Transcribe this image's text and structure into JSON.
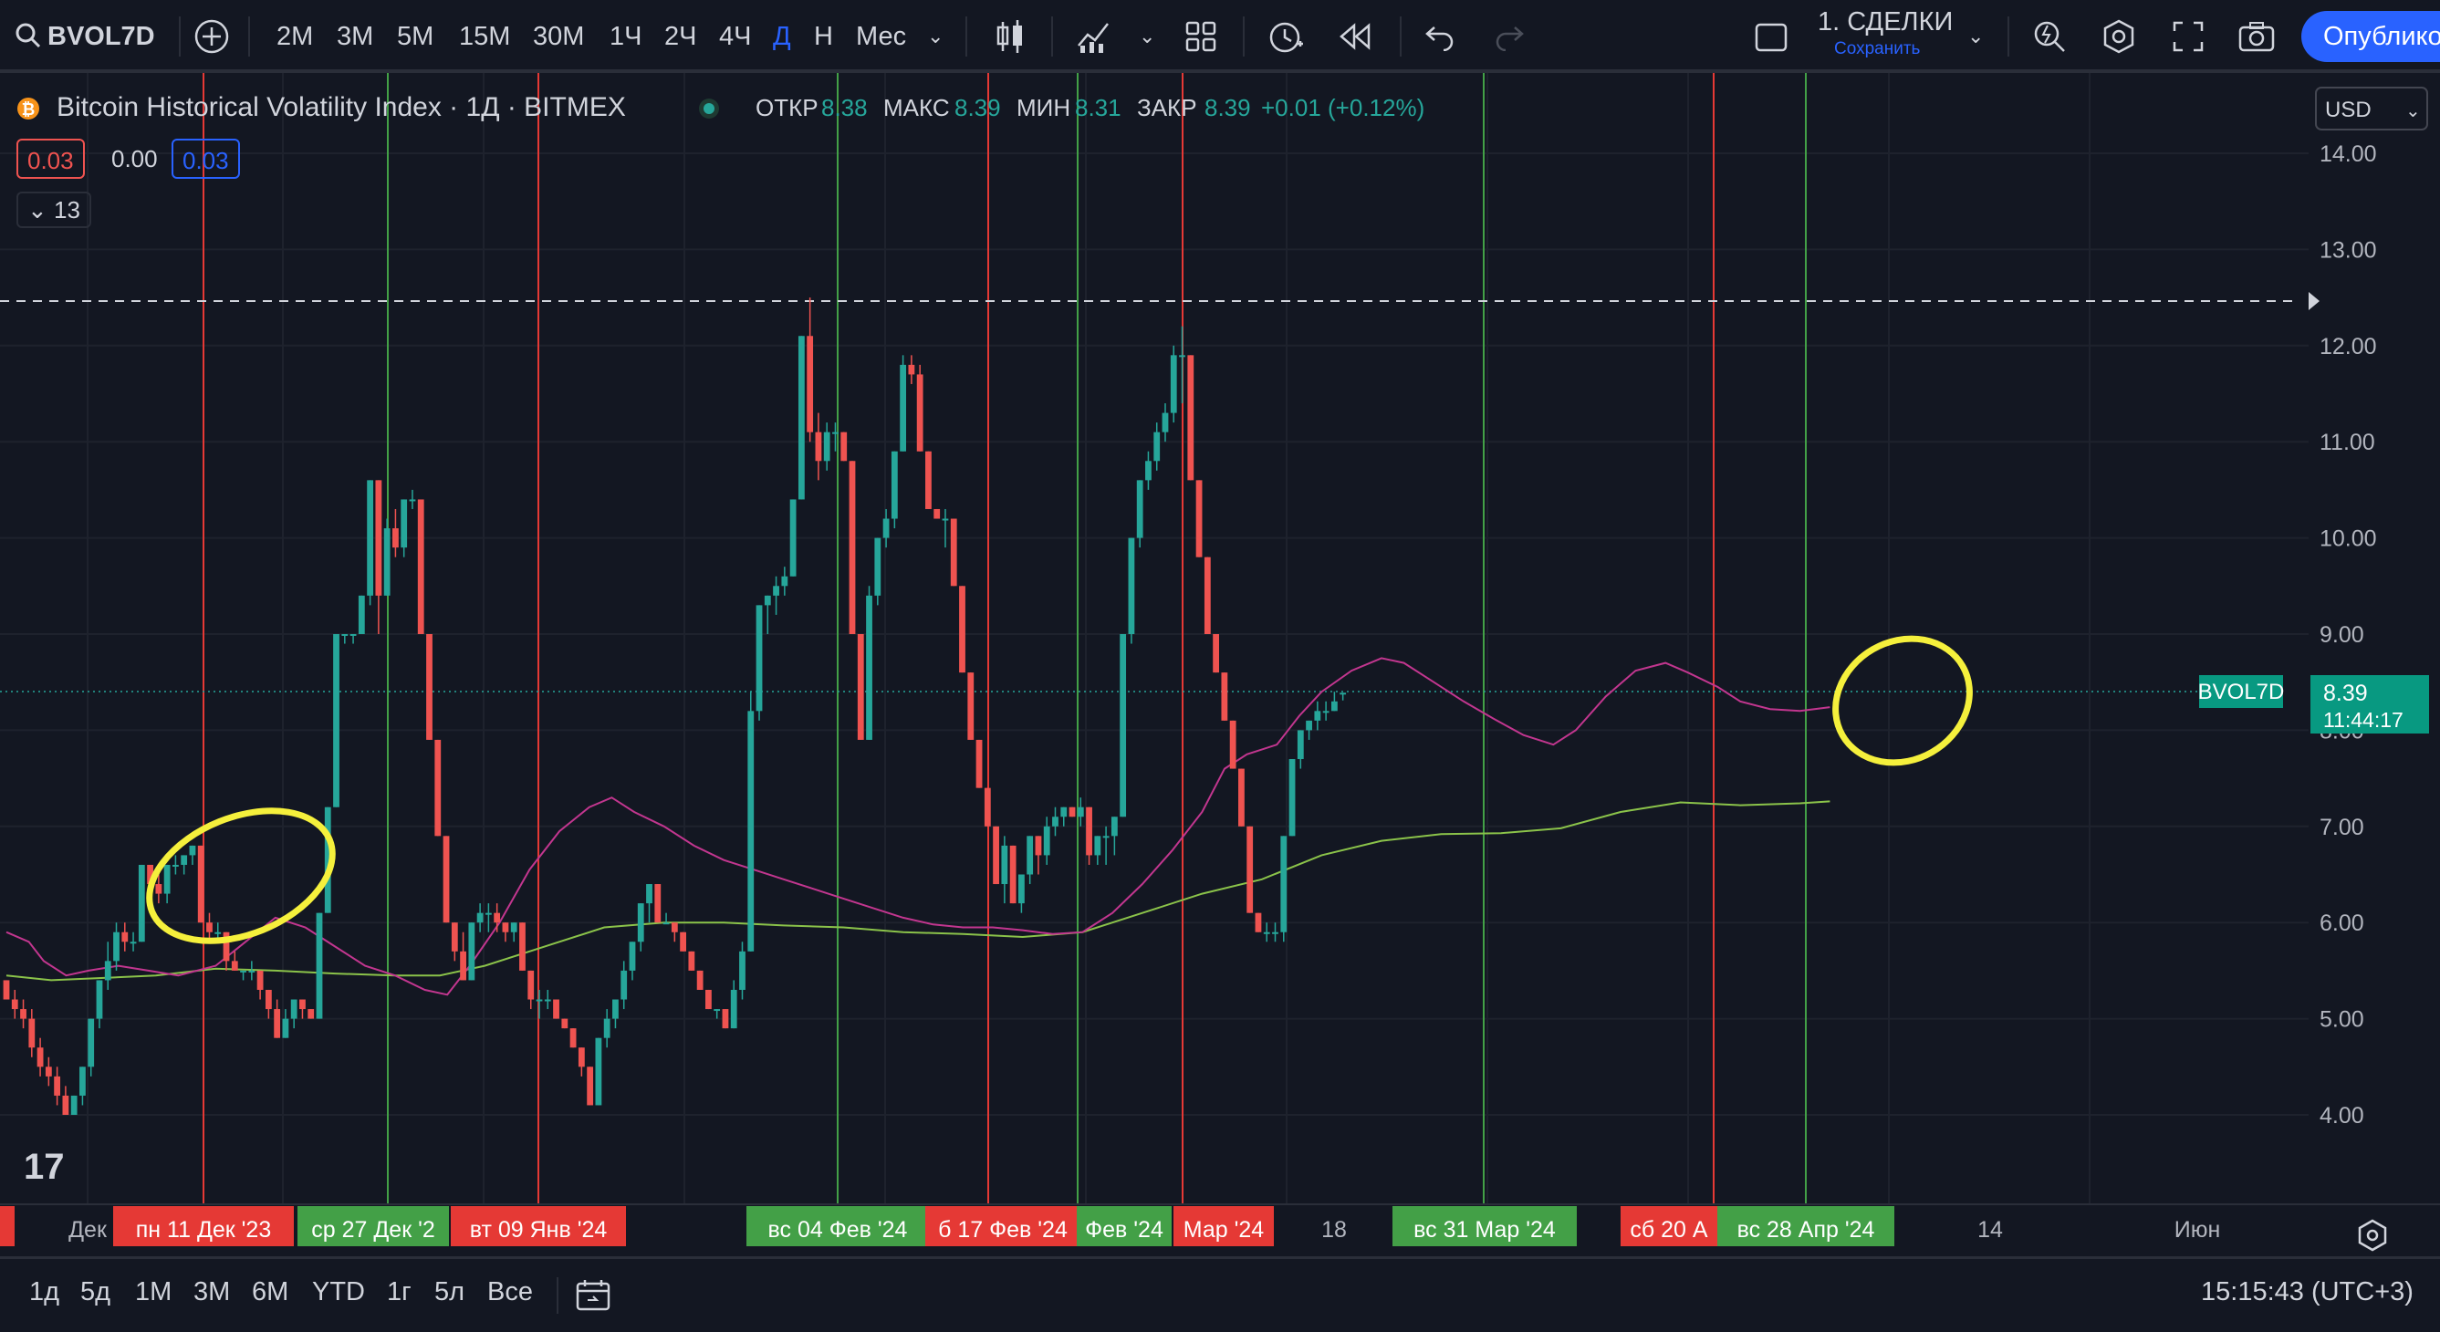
{
  "toolbar": {
    "symbol": "BVOL7D",
    "intervals": [
      "2М",
      "3М",
      "5М",
      "15М",
      "30М",
      "1Ч",
      "2Ч",
      "4Ч",
      "Д",
      "Н",
      "Мес"
    ],
    "active_interval": "Д",
    "layout_name": "1. СДЕЛКИ",
    "layout_save": "Сохранить",
    "publish": "Опублико"
  },
  "legend": {
    "title": "Bitcoin Historical Volatility Index · 1Д · BITMEX",
    "open_label": "ОТКР",
    "open": "8.38",
    "high_label": "МАКС",
    "high": "8.39",
    "low_label": "МИН",
    "low": "8.31",
    "close_label": "ЗАКР",
    "close": "8.39",
    "change": "+0.01 (+0.12%)",
    "sell_price": "0.03",
    "spread": "0.00",
    "buy_price": "0.03",
    "indicators_count": "13"
  },
  "price_scale": {
    "currency": "USD",
    "labels": [
      "14.00",
      "13.00",
      "12.00",
      "11.00",
      "10.00",
      "9.00",
      "8.00",
      "7.00",
      "6.00",
      "5.00",
      "4.00"
    ],
    "last_symbol": "BVOL7D",
    "last_price": "8.39",
    "countdown": "11:44:17"
  },
  "time_axis": {
    "labels": [
      "Дек",
      "18",
      "14",
      "Июн"
    ],
    "markers_red": [
      "пн 11 Дек '23",
      "вт 09 Янв '24",
      "б 17 Фев '24",
      "Мар '24",
      "сб 20 А"
    ],
    "markers_green": [
      "ср 27 Дек '2",
      "вс 04 Фев '24",
      "Фев '24",
      "вс 31 Мар '24",
      "вс 28 Апр '24"
    ]
  },
  "bottom": {
    "ranges": [
      "1д",
      "5д",
      "1М",
      "3М",
      "6М",
      "YTD",
      "1г",
      "5л",
      "Все"
    ],
    "clock": "15:15:43 (UTC+3)"
  },
  "colors": {
    "up": "#26a69a",
    "down": "#ef5350",
    "accent": "#2962ff",
    "ma_fast": "#c2368f",
    "ma_slow": "#8bc34a",
    "highlight": "#f5f03c",
    "vline_red": "#e53935",
    "vline_green": "#43a047"
  },
  "chart_data": {
    "type": "candlestick",
    "ylim": [
      3.5,
      14.5
    ],
    "candles": [
      [
        5.4,
        5.4,
        5.2,
        5.2
      ],
      [
        5.2,
        5.3,
        5.0,
        5.1
      ],
      [
        5.1,
        5.2,
        4.9,
        5.0
      ],
      [
        5.0,
        5.1,
        4.6,
        4.7
      ],
      [
        4.7,
        4.8,
        4.4,
        4.5
      ],
      [
        4.5,
        4.6,
        4.3,
        4.4
      ],
      [
        4.4,
        4.5,
        4.1,
        4.2
      ],
      [
        4.2,
        4.3,
        4.0,
        4.0
      ],
      [
        4.0,
        4.2,
        4.0,
        4.2
      ],
      [
        4.2,
        4.5,
        4.1,
        4.5
      ],
      [
        4.5,
        5.0,
        4.4,
        5.0
      ],
      [
        5.0,
        5.4,
        4.9,
        5.4
      ],
      [
        5.4,
        5.8,
        5.3,
        5.6
      ],
      [
        5.6,
        6.0,
        5.5,
        5.9
      ],
      [
        5.9,
        6.0,
        5.7,
        5.8
      ],
      [
        5.8,
        5.9,
        5.7,
        5.8
      ],
      [
        5.8,
        6.6,
        5.8,
        6.6
      ],
      [
        6.6,
        6.6,
        6.3,
        6.4
      ],
      [
        6.4,
        6.5,
        6.2,
        6.3
      ],
      [
        6.3,
        6.6,
        6.2,
        6.6
      ],
      [
        6.6,
        6.7,
        6.5,
        6.6
      ],
      [
        6.6,
        6.7,
        6.5,
        6.7
      ],
      [
        6.7,
        6.8,
        6.6,
        6.8
      ],
      [
        6.8,
        6.8,
        6.0,
        6.0
      ],
      [
        6.0,
        6.1,
        5.8,
        5.9
      ],
      [
        5.9,
        6.0,
        5.8,
        5.9
      ],
      [
        5.9,
        5.9,
        5.5,
        5.6
      ],
      [
        5.6,
        5.7,
        5.5,
        5.5
      ],
      [
        5.5,
        5.5,
        5.4,
        5.5
      ],
      [
        5.5,
        5.6,
        5.4,
        5.5
      ],
      [
        5.5,
        5.5,
        5.2,
        5.3
      ],
      [
        5.3,
        5.3,
        5.0,
        5.1
      ],
      [
        5.1,
        5.2,
        4.8,
        4.8
      ],
      [
        4.8,
        5.1,
        4.8,
        5.0
      ],
      [
        5.0,
        5.2,
        4.9,
        5.2
      ],
      [
        5.2,
        5.2,
        5.0,
        5.1
      ],
      [
        5.1,
        5.1,
        5.0,
        5.0
      ],
      [
        5.0,
        6.1,
        5.0,
        6.1
      ],
      [
        6.1,
        7.2,
        6.1,
        7.2
      ],
      [
        7.2,
        9.0,
        7.2,
        9.0
      ],
      [
        9.0,
        9.0,
        8.9,
        9.0
      ],
      [
        9.0,
        9.0,
        8.9,
        9.0
      ],
      [
        9.0,
        9.4,
        9.0,
        9.4
      ],
      [
        9.4,
        10.6,
        9.3,
        10.6
      ],
      [
        10.6,
        10.6,
        9.0,
        9.4
      ],
      [
        9.4,
        10.2,
        9.4,
        10.1
      ],
      [
        10.1,
        10.3,
        9.8,
        9.9
      ],
      [
        9.9,
        10.4,
        9.8,
        10.4
      ],
      [
        10.4,
        10.5,
        10.3,
        10.4
      ],
      [
        10.4,
        10.4,
        9.0,
        9.0
      ],
      [
        9.0,
        9.0,
        7.9,
        7.9
      ],
      [
        7.9,
        7.9,
        6.9,
        6.9
      ],
      [
        6.9,
        6.9,
        6.0,
        6.0
      ],
      [
        6.0,
        6.0,
        5.6,
        5.7
      ],
      [
        5.7,
        5.9,
        5.4,
        5.4
      ],
      [
        5.4,
        6.0,
        5.4,
        6.0
      ],
      [
        6.0,
        6.2,
        5.9,
        6.1
      ],
      [
        6.1,
        6.2,
        5.9,
        6.1
      ],
      [
        6.1,
        6.2,
        5.9,
        6.0
      ],
      [
        6.0,
        6.0,
        5.8,
        5.9
      ],
      [
        5.9,
        6.0,
        5.8,
        6.0
      ],
      [
        6.0,
        6.0,
        5.5,
        5.5
      ],
      [
        5.5,
        5.5,
        5.1,
        5.2
      ],
      [
        5.2,
        5.3,
        5.0,
        5.2
      ],
      [
        5.2,
        5.3,
        5.1,
        5.2
      ],
      [
        5.2,
        5.2,
        5.0,
        5.0
      ],
      [
        5.0,
        5.0,
        4.9,
        4.9
      ],
      [
        4.9,
        4.9,
        4.7,
        4.7
      ],
      [
        4.7,
        4.7,
        4.4,
        4.5
      ],
      [
        4.5,
        4.5,
        4.1,
        4.1
      ],
      [
        4.1,
        4.8,
        4.1,
        4.8
      ],
      [
        4.8,
        5.1,
        4.7,
        5.0
      ],
      [
        5.0,
        5.2,
        4.9,
        5.2
      ],
      [
        5.2,
        5.6,
        5.1,
        5.5
      ],
      [
        5.5,
        5.8,
        5.4,
        5.8
      ],
      [
        5.8,
        6.2,
        5.7,
        6.2
      ],
      [
        6.2,
        6.4,
        6.0,
        6.4
      ],
      [
        6.4,
        6.4,
        6.0,
        6.0
      ],
      [
        6.0,
        6.1,
        6.0,
        6.0
      ],
      [
        6.0,
        6.0,
        5.8,
        5.9
      ],
      [
        5.9,
        5.9,
        5.7,
        5.7
      ],
      [
        5.7,
        5.7,
        5.5,
        5.5
      ],
      [
        5.5,
        5.5,
        5.3,
        5.3
      ],
      [
        5.3,
        5.3,
        5.1,
        5.1
      ],
      [
        5.1,
        5.1,
        5.0,
        5.1
      ],
      [
        5.1,
        5.1,
        4.9,
        4.9
      ],
      [
        4.9,
        5.4,
        4.9,
        5.3
      ],
      [
        5.3,
        5.8,
        5.2,
        5.7
      ],
      [
        5.7,
        8.4,
        5.7,
        8.2
      ],
      [
        8.2,
        9.3,
        8.1,
        9.3
      ],
      [
        9.3,
        9.4,
        9.0,
        9.4
      ],
      [
        9.4,
        9.6,
        9.2,
        9.5
      ],
      [
        9.5,
        9.7,
        9.4,
        9.6
      ],
      [
        9.6,
        10.4,
        9.6,
        10.4
      ],
      [
        10.4,
        12.1,
        10.4,
        12.1
      ],
      [
        12.1,
        12.5,
        11.0,
        11.1
      ],
      [
        11.1,
        11.3,
        10.6,
        10.8
      ],
      [
        10.8,
        11.2,
        10.7,
        11.1
      ],
      [
        11.1,
        11.2,
        10.9,
        11.1
      ],
      [
        11.1,
        11.1,
        10.8,
        10.8
      ],
      [
        10.8,
        10.8,
        9.0,
        9.0
      ],
      [
        9.0,
        9.0,
        7.9,
        7.9
      ],
      [
        7.9,
        9.5,
        7.9,
        9.4
      ],
      [
        9.4,
        10.0,
        9.3,
        10.0
      ],
      [
        10.0,
        10.3,
        9.9,
        10.2
      ],
      [
        10.2,
        10.9,
        10.1,
        10.9
      ],
      [
        10.9,
        11.9,
        10.9,
        11.8
      ],
      [
        11.8,
        11.9,
        11.6,
        11.7
      ],
      [
        11.7,
        11.8,
        10.9,
        10.9
      ],
      [
        10.9,
        10.9,
        10.3,
        10.3
      ],
      [
        10.3,
        10.3,
        10.2,
        10.2
      ],
      [
        10.2,
        10.3,
        9.9,
        10.2
      ],
      [
        10.2,
        10.2,
        9.5,
        9.5
      ],
      [
        9.5,
        9.5,
        8.6,
        8.6
      ],
      [
        8.6,
        8.6,
        7.9,
        7.9
      ],
      [
        7.9,
        7.9,
        7.4,
        7.4
      ],
      [
        7.4,
        7.4,
        7.0,
        7.0
      ],
      [
        7.0,
        7.0,
        6.4,
        6.4
      ],
      [
        6.4,
        6.9,
        6.2,
        6.8
      ],
      [
        6.8,
        6.8,
        6.2,
        6.2
      ],
      [
        6.2,
        6.5,
        6.1,
        6.5
      ],
      [
        6.5,
        6.9,
        6.4,
        6.9
      ],
      [
        6.9,
        6.9,
        6.5,
        6.7
      ],
      [
        6.7,
        7.1,
        6.6,
        7.0
      ],
      [
        7.0,
        7.2,
        6.9,
        7.1
      ],
      [
        7.1,
        7.2,
        7.0,
        7.2
      ],
      [
        7.2,
        7.2,
        7.1,
        7.1
      ],
      [
        7.1,
        7.3,
        7.0,
        7.2
      ],
      [
        7.2,
        7.2,
        6.6,
        6.7
      ],
      [
        6.7,
        6.9,
        6.6,
        6.9
      ],
      [
        6.9,
        7.0,
        6.6,
        6.9
      ],
      [
        6.9,
        7.1,
        6.7,
        7.1
      ],
      [
        7.1,
        9.0,
        7.1,
        9.0
      ],
      [
        9.0,
        10.0,
        8.9,
        10.0
      ],
      [
        10.0,
        10.6,
        9.9,
        10.6
      ],
      [
        10.6,
        10.9,
        10.5,
        10.8
      ],
      [
        10.8,
        11.2,
        10.7,
        11.1
      ],
      [
        11.1,
        11.4,
        11.0,
        11.3
      ],
      [
        11.3,
        12.0,
        11.2,
        11.9
      ],
      [
        11.9,
        12.2,
        11.4,
        11.9
      ],
      [
        11.9,
        11.9,
        10.6,
        10.6
      ],
      [
        10.6,
        10.6,
        9.8,
        9.8
      ],
      [
        9.8,
        9.8,
        9.0,
        9.0
      ],
      [
        9.0,
        9.0,
        8.6,
        8.6
      ],
      [
        8.6,
        8.6,
        8.1,
        8.1
      ],
      [
        8.1,
        8.1,
        7.6,
        7.6
      ],
      [
        7.6,
        7.6,
        7.0,
        7.0
      ],
      [
        7.0,
        7.0,
        6.1,
        6.1
      ],
      [
        6.1,
        6.1,
        5.9,
        5.9
      ],
      [
        5.9,
        6.0,
        5.8,
        5.9
      ],
      [
        5.9,
        6.0,
        5.8,
        5.9
      ],
      [
        5.9,
        6.9,
        5.8,
        6.9
      ],
      [
        6.9,
        7.7,
        6.9,
        7.7
      ],
      [
        7.7,
        8.0,
        7.6,
        8.0
      ],
      [
        8.0,
        8.1,
        7.9,
        8.1
      ],
      [
        8.1,
        8.3,
        8.0,
        8.2
      ],
      [
        8.2,
        8.3,
        8.1,
        8.2
      ],
      [
        8.2,
        8.4,
        8.2,
        8.3
      ],
      [
        8.38,
        8.39,
        8.31,
        8.39
      ]
    ],
    "ma_fast": [
      [
        0,
        5.9
      ],
      [
        15,
        5.8
      ],
      [
        25,
        5.6
      ],
      [
        40,
        5.45
      ],
      [
        55,
        5.5
      ],
      [
        75,
        5.55
      ],
      [
        95,
        5.5
      ],
      [
        115,
        5.45
      ],
      [
        140,
        5.55
      ],
      [
        160,
        5.8
      ],
      [
        180,
        6.05
      ],
      [
        200,
        5.95
      ],
      [
        220,
        5.75
      ],
      [
        240,
        5.55
      ],
      [
        260,
        5.45
      ],
      [
        280,
        5.3
      ],
      [
        295,
        5.25
      ],
      [
        310,
        5.55
      ],
      [
        330,
        6.0
      ],
      [
        350,
        6.55
      ],
      [
        370,
        6.95
      ],
      [
        390,
        7.2
      ],
      [
        405,
        7.3
      ],
      [
        420,
        7.15
      ],
      [
        440,
        7.0
      ],
      [
        460,
        6.8
      ],
      [
        480,
        6.65
      ],
      [
        500,
        6.55
      ],
      [
        520,
        6.45
      ],
      [
        540,
        6.35
      ],
      [
        560,
        6.25
      ],
      [
        580,
        6.15
      ],
      [
        600,
        6.05
      ],
      [
        620,
        5.98
      ],
      [
        640,
        5.95
      ],
      [
        660,
        5.95
      ],
      [
        680,
        5.92
      ],
      [
        700,
        5.88
      ],
      [
        720,
        5.9
      ],
      [
        740,
        6.1
      ],
      [
        760,
        6.4
      ],
      [
        780,
        6.75
      ],
      [
        800,
        7.15
      ],
      [
        815,
        7.6
      ],
      [
        830,
        7.75
      ],
      [
        850,
        7.85
      ],
      [
        865,
        8.15
      ],
      [
        880,
        8.4
      ],
      [
        900,
        8.62
      ],
      [
        920,
        8.75
      ],
      [
        935,
        8.7
      ],
      [
        955,
        8.5
      ],
      [
        975,
        8.3
      ],
      [
        995,
        8.12
      ],
      [
        1015,
        7.95
      ],
      [
        1035,
        7.85
      ],
      [
        1050,
        8.0
      ],
      [
        1070,
        8.35
      ],
      [
        1090,
        8.62
      ],
      [
        1110,
        8.7
      ],
      [
        1125,
        8.6
      ],
      [
        1145,
        8.45
      ],
      [
        1160,
        8.3
      ],
      [
        1180,
        8.22
      ],
      [
        1200,
        8.2
      ],
      [
        1220,
        8.24
      ]
    ],
    "ma_slow": [
      [
        0,
        5.45
      ],
      [
        30,
        5.4
      ],
      [
        60,
        5.42
      ],
      [
        100,
        5.45
      ],
      [
        140,
        5.52
      ],
      [
        180,
        5.5
      ],
      [
        220,
        5.47
      ],
      [
        260,
        5.45
      ],
      [
        290,
        5.45
      ],
      [
        320,
        5.55
      ],
      [
        360,
        5.75
      ],
      [
        400,
        5.95
      ],
      [
        440,
        6.0
      ],
      [
        480,
        6.0
      ],
      [
        520,
        5.97
      ],
      [
        560,
        5.95
      ],
      [
        600,
        5.9
      ],
      [
        640,
        5.88
      ],
      [
        680,
        5.85
      ],
      [
        720,
        5.9
      ],
      [
        760,
        6.1
      ],
      [
        800,
        6.3
      ],
      [
        840,
        6.45
      ],
      [
        880,
        6.7
      ],
      [
        920,
        6.85
      ],
      [
        960,
        6.92
      ],
      [
        1000,
        6.93
      ],
      [
        1040,
        6.98
      ],
      [
        1080,
        7.15
      ],
      [
        1120,
        7.25
      ],
      [
        1160,
        7.22
      ],
      [
        1200,
        7.24
      ],
      [
        1220,
        7.26
      ]
    ]
  }
}
